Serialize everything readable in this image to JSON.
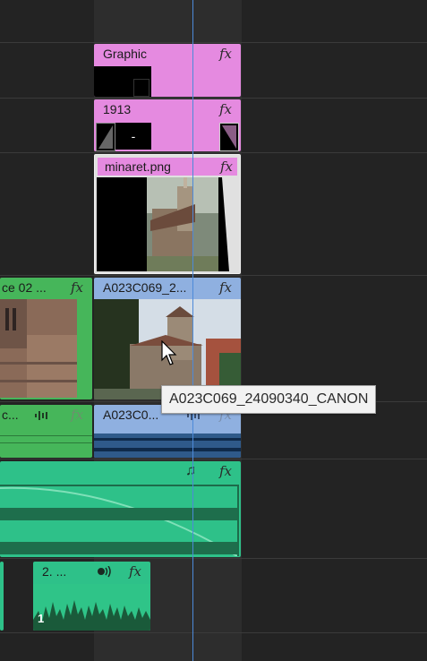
{
  "clips": {
    "graphic": {
      "label": "Graphic",
      "fx": "fx"
    },
    "c1913": {
      "label": "1913",
      "fx": "fx",
      "dash": "-"
    },
    "minaret": {
      "label": "minaret.png",
      "fx": "fx"
    },
    "video_left": {
      "label": "ce 02 ...",
      "fx": "fx"
    },
    "video_main": {
      "label": "A023C069_2...",
      "fx": "fx"
    },
    "audio_left": {
      "label": "c...",
      "fx": "fx"
    },
    "audio_main": {
      "label": "A023C0...",
      "fx": "fx"
    },
    "music": {
      "fx": "fx",
      "music_icon": "♫"
    },
    "voice": {
      "label": "2. ...",
      "fx": "fx",
      "badge": "1"
    }
  },
  "tooltip": {
    "text": "A023C069_24090340_CANON"
  },
  "icons": {
    "playhead": "playhead",
    "cursor": "arrow-cursor",
    "audio_waveform": "waveform-icon",
    "speech": "speech-icon",
    "music": "music-note-icon"
  },
  "colors": {
    "graphic_clip": "#e58ae0",
    "video_clip": "#8fb0e0",
    "green_clip": "#46b65a",
    "audio_clip": "#2ec189",
    "playhead": "#4d8ad9"
  }
}
